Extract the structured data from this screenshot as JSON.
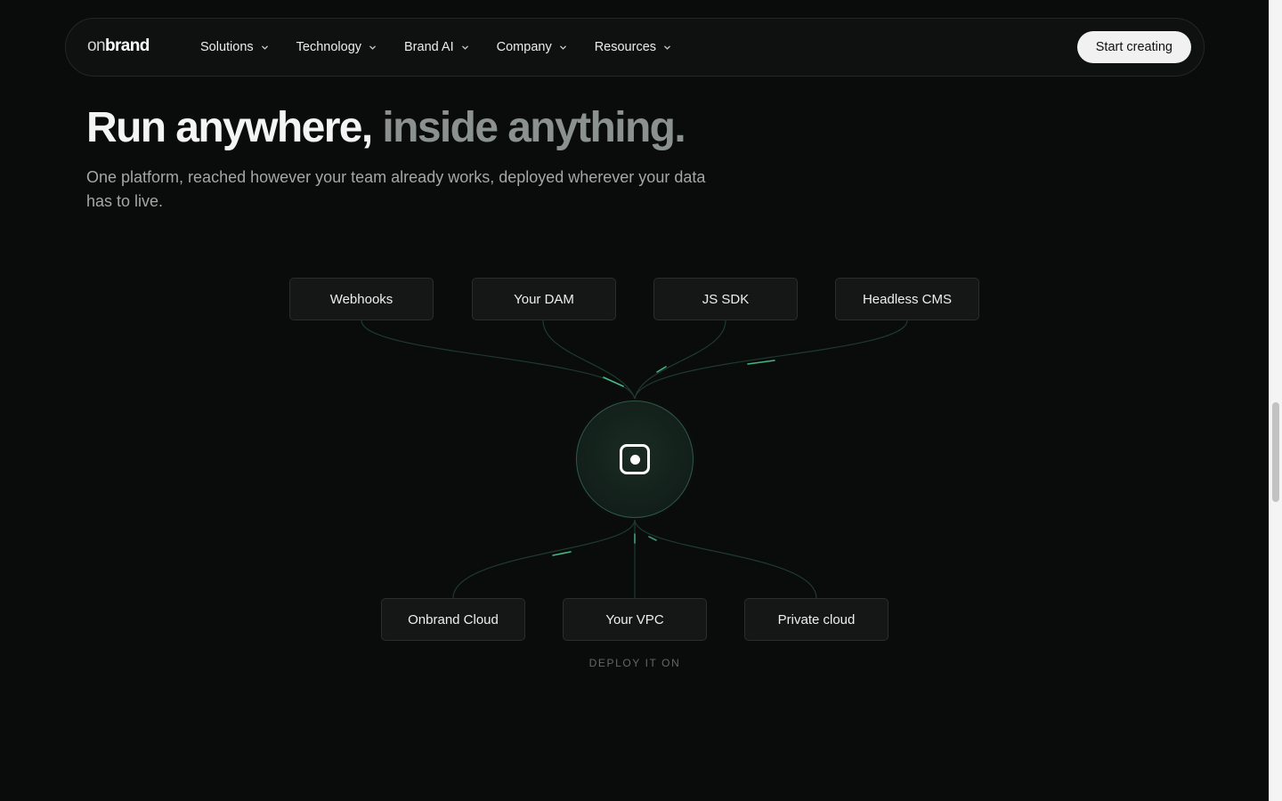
{
  "nav": {
    "logo_light": "on",
    "logo_bold": "brand",
    "items": [
      {
        "label": "Solutions"
      },
      {
        "label": "Technology"
      },
      {
        "label": "Brand AI"
      },
      {
        "label": "Company"
      },
      {
        "label": "Resources"
      }
    ],
    "cta_label": "Start creating"
  },
  "hero": {
    "headline_primary": "Run anywhere,",
    "headline_secondary": "inside anything.",
    "subtitle": "One platform, reached however your team already works, deployed wherever your data has to live."
  },
  "diagram": {
    "sources": [
      "Webhooks",
      "Your DAM",
      "JS SDK",
      "Headless CMS"
    ],
    "hub_icon": "target-square-icon",
    "targets": [
      "Onbrand Cloud",
      "Your VPC",
      "Private cloud"
    ],
    "deploy_label": "DEPLOY IT ON"
  },
  "colors": {
    "background": "#0a0b0b",
    "accent_green": "#4fd39a",
    "muted_text": "#8a918f",
    "cta_background": "#f1f1f1"
  }
}
